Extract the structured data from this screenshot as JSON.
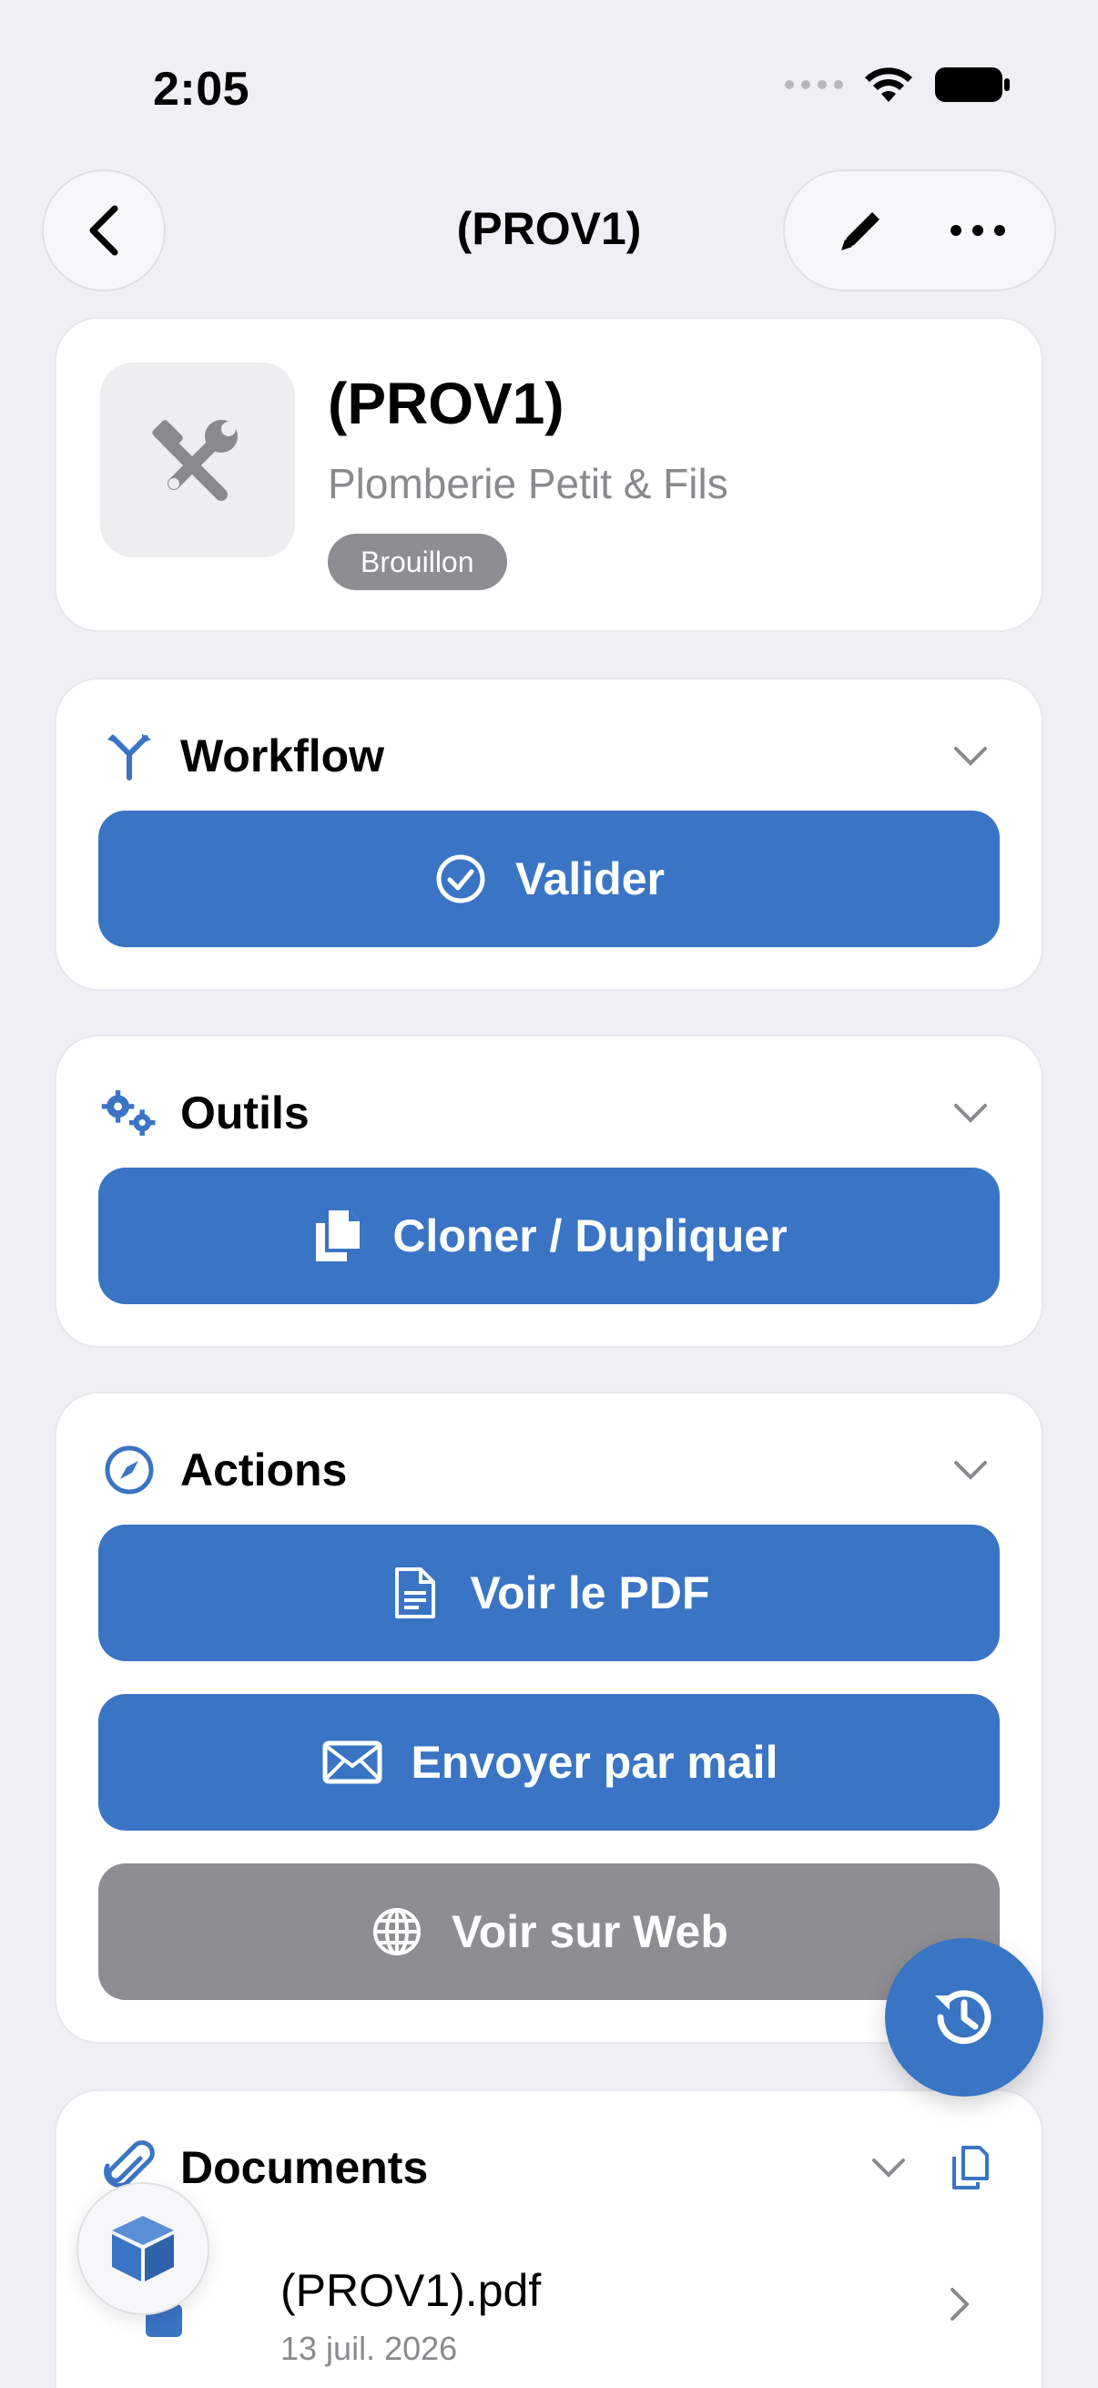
{
  "status": {
    "time": "2:05"
  },
  "nav": {
    "title": "(PROV1)",
    "back_icon": "chevron-left-icon",
    "edit_icon": "pencil-icon",
    "more_icon": "ellipsis-icon"
  },
  "header": {
    "title": "(PROV1)",
    "subtitle": "Plomberie Petit & Fils",
    "badge": "Brouillon",
    "thumb_icon": "tools-icon"
  },
  "workflow": {
    "title": "Workflow",
    "button": "Valider"
  },
  "outils": {
    "title": "Outils",
    "button": "Cloner / Dupliquer"
  },
  "actions": {
    "title": "Actions",
    "buttons": [
      "Voir le PDF",
      "Envoyer par mail",
      "Voir sur Web"
    ]
  },
  "documents": {
    "title": "Documents",
    "items": [
      {
        "name": "(PROV1).pdf",
        "date": "13 juil. 2026"
      }
    ]
  },
  "colors": {
    "accent": "#3a74c4",
    "muted": "#8e8e92",
    "background": "#f0f0f4"
  }
}
